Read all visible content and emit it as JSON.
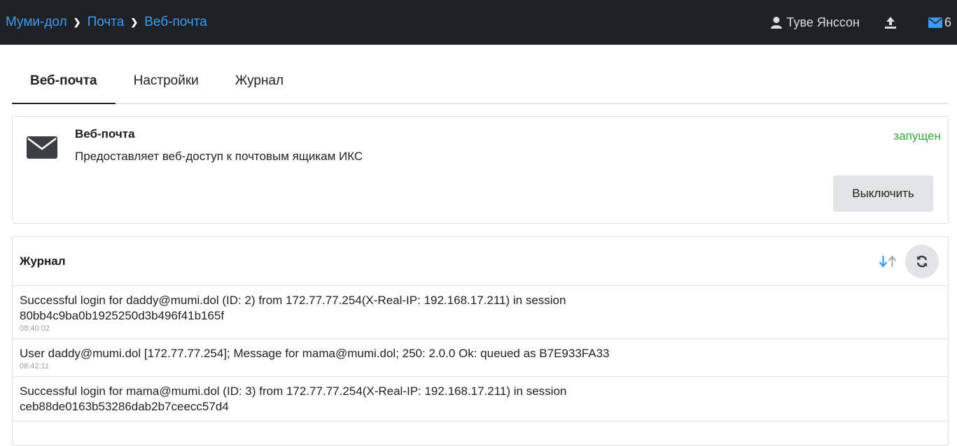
{
  "breadcrumb": {
    "items": [
      "Муми-дол",
      "Почта",
      "Веб-почта"
    ]
  },
  "user": {
    "name": "Туве Янссон"
  },
  "mail": {
    "count": "6"
  },
  "tabs": [
    {
      "label": "Веб-почта",
      "active": true
    },
    {
      "label": "Настройки",
      "active": false
    },
    {
      "label": "Журнал",
      "active": false
    }
  ],
  "service": {
    "title": "Веб-почта",
    "description": "Предоставляет веб-доступ к почтовым ящикам ИКС",
    "status": "запущен",
    "status_color": "#3aa53a",
    "button_label": "Выключить"
  },
  "log": {
    "title": "Журнал",
    "entries": [
      {
        "message": "Successful login for daddy@mumi.dol (ID: 2) from 172.77.77.254(X-Real-IP: 192.168.17.211) in session 80bb4c9ba0b1925250d3b496f41b165f",
        "time": "08:40:02"
      },
      {
        "message": "User daddy@mumi.dol [172.77.77.254]; Message for mama@mumi.dol; 250: 2.0.0 Ok: queued as B7E933FA33",
        "time": "08:42:11"
      },
      {
        "message": "Successful login for mama@mumi.dol (ID: 3) from 172.77.77.254(X-Real-IP: 192.168.17.211) in session ceb88de0163b53286dab2b7ceecc57d4",
        "time": ""
      }
    ]
  },
  "colors": {
    "accent": "#3f9bf0",
    "topbar": "#1e2126"
  },
  "icons": {
    "user": "user-icon",
    "upload": "upload-icon",
    "mail": "envelope-icon",
    "service": "envelope-icon",
    "sort_desc": "arrow-down-icon",
    "sort_asc": "arrow-up-icon",
    "refresh": "refresh-icon"
  }
}
